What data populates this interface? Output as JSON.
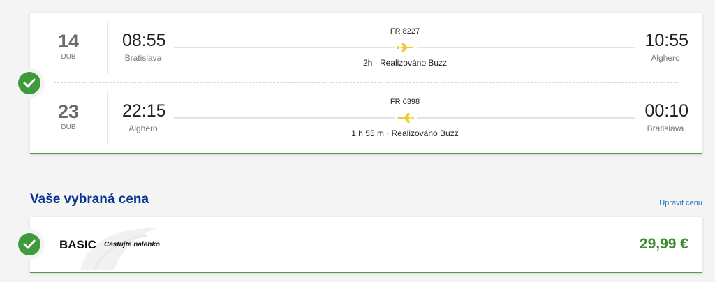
{
  "flights": [
    {
      "day": "14",
      "month": "DUB",
      "dep_time": "08:55",
      "dep_city": "Bratislava",
      "arr_time": "10:55",
      "arr_city": "Alghero",
      "flight_no": "FR 8227",
      "operated": "2h · Realizováno Buzz"
    },
    {
      "day": "23",
      "month": "DUB",
      "dep_time": "22:15",
      "dep_city": "Alghero",
      "arr_time": "00:10",
      "arr_city": "Bratislava",
      "flight_no": "FR 6398",
      "operated": "1 h 55 m · Realizováno Buzz"
    }
  ],
  "price_section": {
    "title": "Vaše vybraná cena",
    "edit_label": "Upravit cenu",
    "fare_name": "BASIC",
    "fare_desc": "Cestujte nalehko",
    "price": "29,99 €"
  },
  "icons": {
    "check": "check-icon",
    "plane_outbound": "plane-right-icon",
    "plane_return": "plane-left-icon"
  },
  "colors": {
    "accent_green": "#3e9a3a",
    "title_blue": "#073590",
    "link_blue": "#1670c4",
    "plane_yellow": "#f1c933"
  }
}
